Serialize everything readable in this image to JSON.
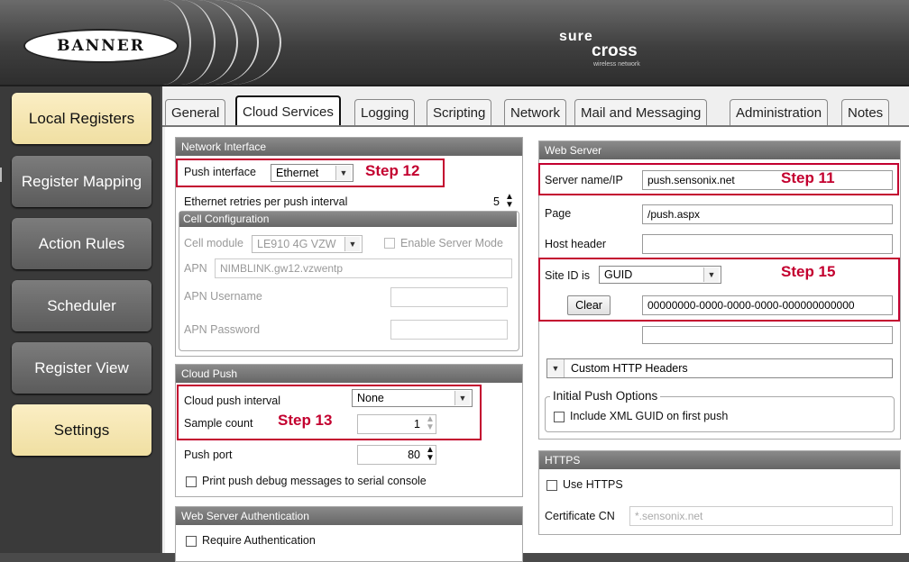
{
  "header": {
    "banner_logo": "BANNER",
    "surecross": {
      "w1": "sure",
      "w2": "cross",
      "tag": "wireless network"
    }
  },
  "sidebar": {
    "items": [
      {
        "label": "Local Registers",
        "active": true
      },
      {
        "label": "Register Mapping",
        "active": false
      },
      {
        "label": "Action Rules",
        "active": false
      },
      {
        "label": "Scheduler",
        "active": false
      },
      {
        "label": "Register View",
        "active": false
      },
      {
        "label": "Settings",
        "active": true
      }
    ]
  },
  "tabs": [
    "General",
    "Cloud Services",
    "Logging",
    "Scripting",
    "Network",
    "Mail and Messaging",
    "Administration",
    "Notes"
  ],
  "network_interface": {
    "title": "Network Interface",
    "push_interface_label": "Push interface",
    "push_interface_value": "Ethernet",
    "ethernet_retries_label": "Ethernet retries per push interval",
    "ethernet_retries_value": "5",
    "cell_config_title": "Cell Configuration",
    "cell_module_label": "Cell module",
    "cell_module_value": "LE910 4G VZW",
    "enable_server_mode_label": "Enable Server Mode",
    "apn_label": "APN",
    "apn_value": "NIMBLINK.gw12.vzwentp",
    "apn_username_label": "APN Username",
    "apn_password_label": "APN Password"
  },
  "cloud_push": {
    "title": "Cloud Push",
    "interval_label": "Cloud push interval",
    "interval_value": "None",
    "sample_count_label": "Sample count",
    "sample_count_value": "1",
    "push_port_label": "Push port",
    "push_port_value": "80",
    "debug_label": "Print push debug messages to serial console"
  },
  "web_server_auth": {
    "title": "Web Server Authentication",
    "require_auth_label": "Require Authentication"
  },
  "web_server": {
    "title": "Web Server",
    "server_name_label": "Server name/IP",
    "server_name_value": "push.sensonix.net",
    "page_label": "Page",
    "page_value": "/push.aspx",
    "host_header_label": "Host header",
    "site_id_label": "Site ID is",
    "site_id_value": "GUID",
    "clear_label": "Clear",
    "guid_value": "00000000-0000-0000-0000-000000000000",
    "custom_headers_label": "Custom HTTP Headers",
    "initial_push_title": "Initial Push Options",
    "include_guid_label": "Include XML GUID on first push"
  },
  "https": {
    "title": "HTTPS",
    "use_https_label": "Use HTTPS",
    "cert_cn_label": "Certificate CN",
    "cert_cn_placeholder": "*.sensonix.net"
  },
  "steps": {
    "s11": "Step 11",
    "s12": "Step 12",
    "s13": "Step 13",
    "s15": "Step 15"
  },
  "colors": {
    "annotation_red": "#c3002f",
    "active_nav": "#f6e6b4"
  }
}
